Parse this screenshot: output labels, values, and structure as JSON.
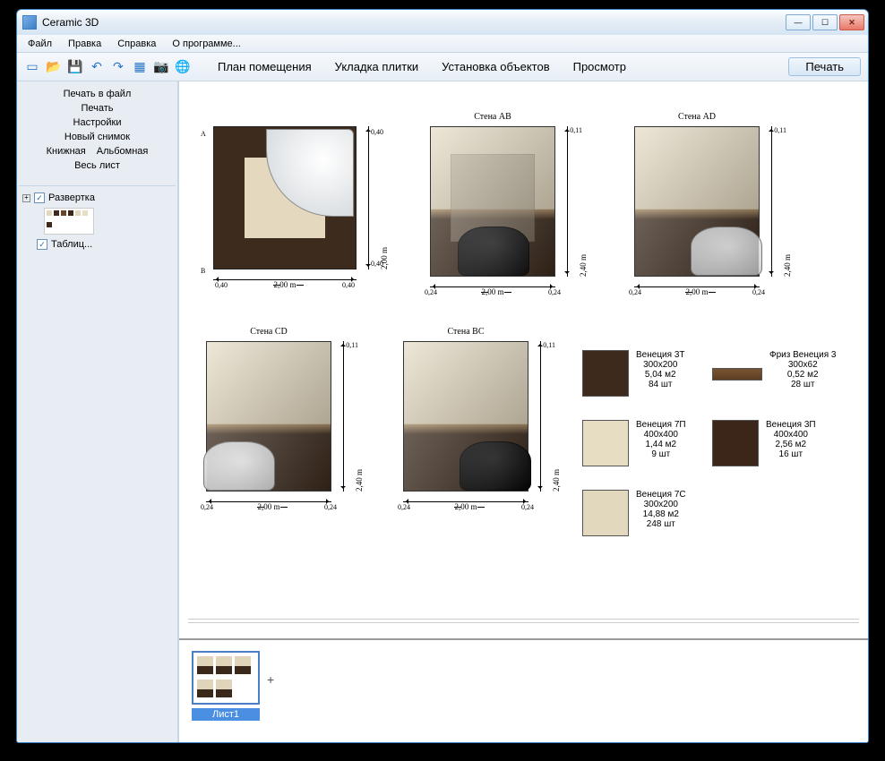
{
  "window": {
    "title": "Ceramic 3D"
  },
  "menubar": {
    "file": "Файл",
    "edit": "Правка",
    "help": "Справка",
    "about": "О программе..."
  },
  "toolbar": {
    "mode_plan": "План помещения",
    "mode_tile": "Укладка плитки",
    "mode_objects": "Установка объектов",
    "mode_preview": "Просмотр",
    "mode_print": "Печать"
  },
  "sidebar": {
    "print_to_file": "Печать в файл",
    "print": "Печать",
    "settings": "Настройки",
    "new_snapshot": "Новый снимок",
    "portrait": "Книжная",
    "landscape": "Альбомная",
    "whole_sheet": "Весь лист",
    "tree_unfold": "Развертка",
    "tree_table": "Таблиц..."
  },
  "walls": {
    "planA": "A",
    "planB": "B",
    "plan_w": "2,00 m",
    "plan_h": "2,00 m",
    "plan_edge": "0,40",
    "ab": {
      "label": "Стена AB",
      "w": "2,00 m",
      "h": "2,40 m",
      "e": "0,24",
      "t": "0,11"
    },
    "ad": {
      "label": "Стена AD",
      "w": "2,00 m",
      "h": "2,40 m",
      "e": "0,24",
      "t": "0,11"
    },
    "cd": {
      "label": "Стена CD",
      "w": "2,00 m",
      "h": "2,40 m",
      "e": "0,24",
      "t": "0,11"
    },
    "bc": {
      "label": "Стена BC",
      "w": "2,00 m",
      "h": "2,40 m",
      "e": "0,24",
      "t": "0,11"
    }
  },
  "tiles": [
    {
      "name": "Венеция 3Т",
      "size": "300х200",
      "area": "5,04 м2",
      "qty": "84 шт",
      "color": "#3e2a1c"
    },
    {
      "name": "Фриз Венеция 3",
      "size": "300х62",
      "area": "0,52 м2",
      "qty": "28 шт",
      "color": "#6a4628"
    },
    {
      "name": "Венеция 7П",
      "size": "400х400",
      "area": "1,44 м2",
      "qty": "9 шт",
      "color": "#e7ddc3"
    },
    {
      "name": "Венеция 3П",
      "size": "400х400",
      "area": "2,56 м2",
      "qty": "16 шт",
      "color": "#3c2519"
    },
    {
      "name": "Венеция 7С",
      "size": "300х200",
      "area": "14,88 м2",
      "qty": "248 шт",
      "color": "#e2d8bd"
    }
  ],
  "page": {
    "label": "Лист1"
  }
}
